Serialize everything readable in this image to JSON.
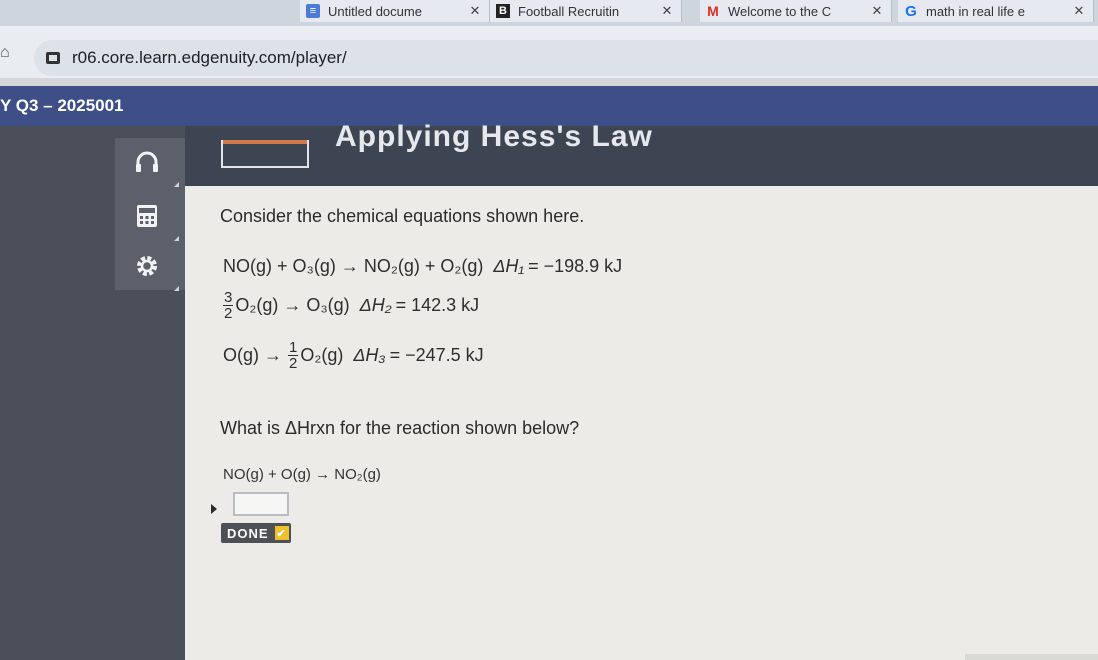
{
  "browser": {
    "tabs": [
      {
        "title": "Untitled docume",
        "icon": "google-docs-icon",
        "color": "#4a7bd8"
      },
      {
        "title": "Football Recruitin",
        "icon": "hudl-icon",
        "color": "#222222"
      },
      {
        "title": "Welcome to the C",
        "icon": "gmail-icon",
        "color": "#d93025"
      },
      {
        "title": "math in real life e",
        "icon": "google-icon",
        "color": "#1a73e8"
      }
    ],
    "url": "r06.core.learn.edgenuity.com/player/"
  },
  "header": {
    "course": "Y Q3 – 2025001",
    "activity_title": "Applying Hess's Law"
  },
  "tools": [
    "headphones-icon",
    "calculator-icon",
    "settings-icon"
  ],
  "content": {
    "intro": "Consider the chemical equations shown here.",
    "eq1": {
      "reaction": "NO(g) + O₃(g) → NO₂(g) + O₂(g)",
      "dh_label": "ΔH₁",
      "dh_value": "= −198.9 kJ"
    },
    "eq2": {
      "coef_num": "3",
      "coef_den": "2",
      "reaction": "O₂(g) → O₃(g)",
      "dh_label": "ΔH₂",
      "dh_value": "= 142.3 kJ"
    },
    "eq3": {
      "lhs": "O(g) →",
      "coef_num": "1",
      "coef_den": "2",
      "rhs": "O₂(g)",
      "dh_label": "ΔH₃",
      "dh_value": "= −247.5 kJ"
    },
    "question": "What is ΔHrxn for the reaction shown below?",
    "target": "NO(g) + O(g) → NO₂(g)",
    "answer_value": "",
    "done_label": "DONE"
  }
}
